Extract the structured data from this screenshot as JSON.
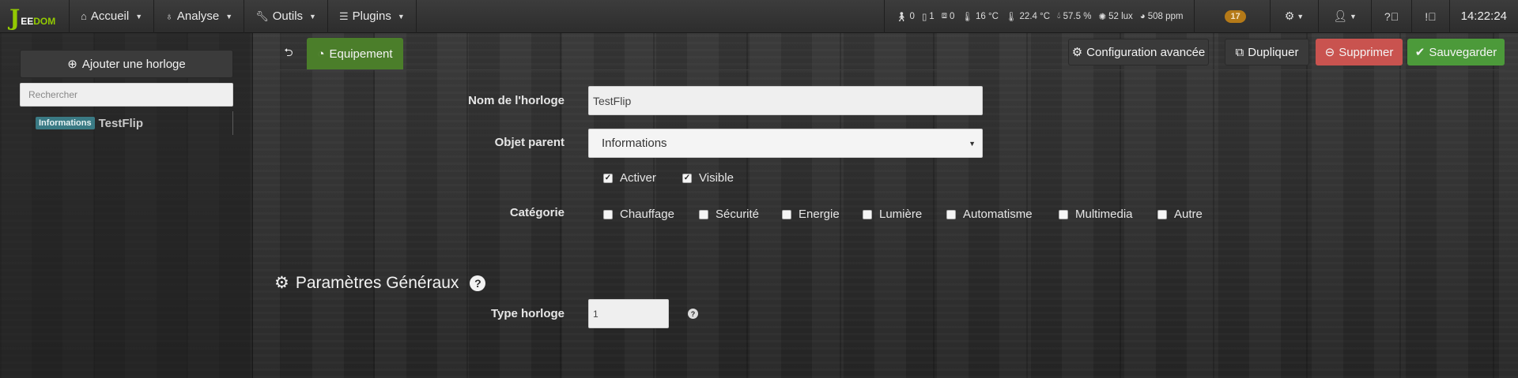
{
  "brand": {
    "logo_letter": "J",
    "logo_text_1": "EE",
    "logo_text_2": "DOM"
  },
  "nav": {
    "home": "Accueil",
    "analysis": "Analyse",
    "tools": "Outils",
    "plugins": "Plugins"
  },
  "status": {
    "motion": "0",
    "door": "1",
    "window": "0",
    "temp_out": "16 °C",
    "temp_in": "22.4 °C",
    "humidity": "57.5 %",
    "lux": "52 lux",
    "co2": "508 ppm"
  },
  "badge_count": "17",
  "clock": "14:22:24",
  "sidebar": {
    "add_label": "Ajouter une horloge",
    "search_placeholder": "Rechercher",
    "items": [
      {
        "tag": "Informations",
        "name": "TestFlip"
      }
    ]
  },
  "tabs": {
    "equipment": "Equipement"
  },
  "actions": {
    "advanced": "Configuration avancée",
    "duplicate": "Dupliquer",
    "delete": "Supprimer",
    "save": "Sauvegarder"
  },
  "form": {
    "name_label": "Nom de l'horloge",
    "name_value": "TestFlip",
    "parent_label": "Objet parent",
    "parent_value": "Informations",
    "activate_label": "Activer",
    "visible_label": "Visible",
    "category_label": "Catégorie",
    "categories": [
      "Chauffage",
      "Sécurité",
      "Energie",
      "Lumière",
      "Automatisme",
      "Multimedia",
      "Autre"
    ],
    "general_title": "Paramètres Généraux",
    "type_label": "Type horloge",
    "type_value": "1"
  },
  "colors": {
    "equip_tab": "#4b7e2a",
    "delete": "#c9534f",
    "save": "#4c9a3a",
    "badge": "#b57a18",
    "tag": "#3a7a84"
  }
}
